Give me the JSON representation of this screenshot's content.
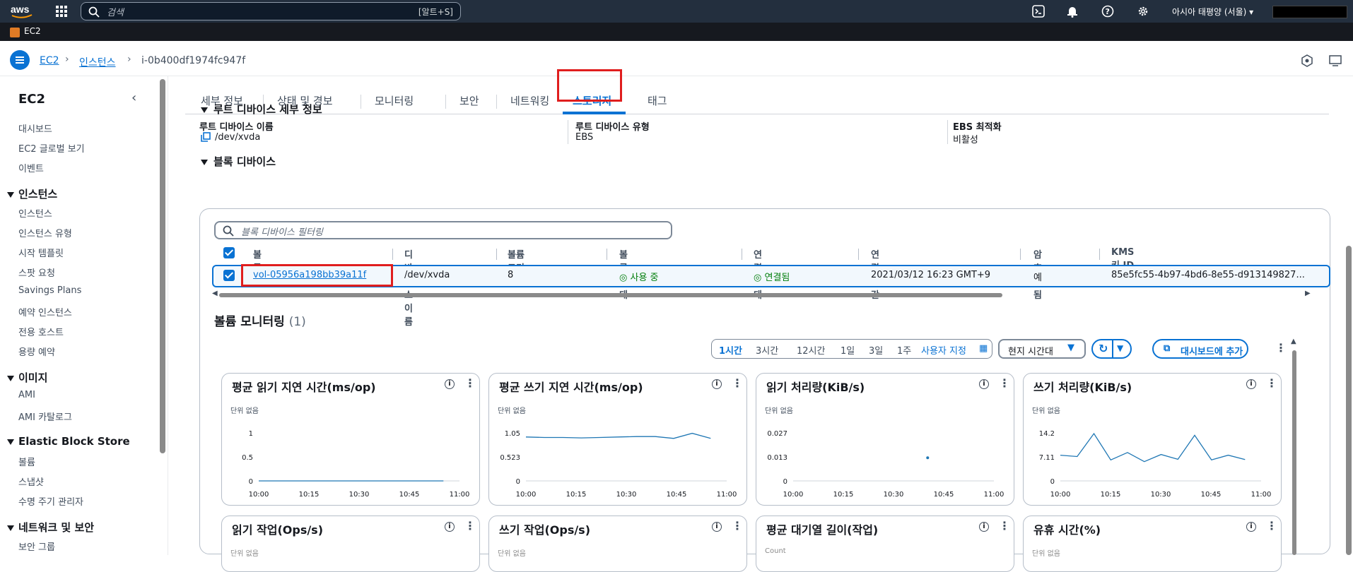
{
  "topnav": {
    "logo": "aws",
    "search_placeholder": "검색",
    "search_shortcut": "[알트+S]",
    "region": "아시아 태평양 (서울)",
    "icons": [
      "cloudshell-icon",
      "bell-icon",
      "help-icon",
      "gear-icon"
    ]
  },
  "service_bar": {
    "label": "EC2"
  },
  "breadcrumb": {
    "items": [
      "EC2",
      "인스턴스",
      "i-0b400df1974fc947f"
    ]
  },
  "sidebar": {
    "title": "EC2",
    "top_items": [
      "대시보드",
      "EC2 글로벌 보기",
      "이벤트"
    ],
    "sections": [
      {
        "title": "인스턴스",
        "items": [
          "인스턴스",
          "인스턴스 유형",
          "시작 템플릿",
          "스팟 요청",
          "Savings Plans",
          "예약 인스턴스",
          "전용 호스트",
          "용량 예약"
        ]
      },
      {
        "title": "이미지",
        "items": [
          "AMI",
          "AMI 카탈로그"
        ]
      },
      {
        "title": "Elastic Block Store",
        "items": [
          "볼륨",
          "스냅샷",
          "수명 주기 관리자"
        ]
      },
      {
        "title": "네트워크 및 보안",
        "items": [
          "보안 그룹"
        ]
      }
    ]
  },
  "tabs": [
    "세부 정보",
    "상태 및 경보",
    "모니터링",
    "보안",
    "네트워킹",
    "스토리지",
    "태그"
  ],
  "active_tab": "스토리지",
  "root_device": {
    "title": "루트 디바이스 세부 정보",
    "name_label": "루트 디바이스 이름",
    "name_value": "/dev/xvda",
    "type_label": "루트 디바이스 유형",
    "type_value": "EBS",
    "ebs_label": "EBS 최적화",
    "ebs_value": "비활성"
  },
  "block_devices": {
    "title": "블록 디바이스",
    "filter_placeholder": "블록 디바이스 필터링",
    "columns": [
      "볼륨 ID",
      "디바이스 이름",
      "볼륨 크기(GiB)",
      "볼륨 상태",
      "연결 상태",
      "연결 시간",
      "암호화됨",
      "KMS 키 ID"
    ],
    "row": {
      "volume_id": "vol-05956a198bb39a11f",
      "device": "/dev/xvda",
      "size": "8",
      "volume_state": "사용 중",
      "attach_state": "연결됨",
      "attach_time": "2021/03/12 16:23 GMT+9",
      "encrypted": "예",
      "kms": "85e5fc55-4b97-4bd6-8e55-d913149827..."
    }
  },
  "monitoring": {
    "title": "볼륨 모니터링",
    "count": "(1)",
    "ranges": [
      "1시간",
      "3시간",
      "12시간",
      "1일",
      "3일",
      "1주"
    ],
    "custom_label": "사용자 지정",
    "timezone": "현지 시간대",
    "add_dashboard": "대시보드에 추가",
    "unit_label": "단위 없음",
    "x_ticks": [
      "10:00",
      "10:15",
      "10:30",
      "10:45",
      "11:00"
    ],
    "cards": [
      {
        "title": "평균 읽기 지연 시간(ms/op)",
        "y_ticks": [
          "1",
          "0.5",
          "0"
        ]
      },
      {
        "title": "평균 쓰기 지연 시간(ms/op)",
        "y_ticks": [
          "1.05",
          "0.523",
          "0"
        ]
      },
      {
        "title": "읽기 처리량(KiB/s)",
        "y_ticks": [
          "0.027",
          "0.013",
          "0"
        ]
      },
      {
        "title": "쓰기 처리량(KiB/s)",
        "y_ticks": [
          "14.2",
          "7.11",
          "0"
        ]
      },
      {
        "title": "읽기 작업(Ops/s)",
        "sub": "단위 없음"
      },
      {
        "title": "쓰기 작업(Ops/s)",
        "sub": "단위 없음"
      },
      {
        "title": "평균 대기열 길이(작업)",
        "sub": "Count"
      },
      {
        "title": "유휴 시간(%)",
        "sub": "단위 없음"
      }
    ]
  },
  "chart_data": [
    {
      "type": "line",
      "title": "평균 읽기 지연 시간(ms/op)",
      "ylim": [
        0,
        1
      ],
      "series": [
        {
          "values": [
            0,
            0,
            0,
            0,
            0,
            0,
            0,
            0,
            0,
            0,
            0
          ]
        }
      ]
    },
    {
      "type": "line",
      "title": "평균 쓰기 지연 시간(ms/op)",
      "ylim": [
        0,
        1.05
      ],
      "series": [
        {
          "values": [
            0.96,
            0.95,
            0.95,
            0.94,
            0.95,
            0.96,
            0.97,
            0.97,
            0.93,
            1.04,
            0.93
          ]
        }
      ]
    },
    {
      "type": "scatter",
      "title": "읽기 처리량(KiB/s)",
      "ylim": [
        0,
        0.027
      ],
      "series": [
        {
          "values": [
            0.013
          ]
        }
      ]
    },
    {
      "type": "line",
      "title": "쓰기 처리량(KiB/s)",
      "ylim": [
        0,
        14.2
      ],
      "series": [
        {
          "values": [
            7.6,
            7.2,
            14.0,
            6.2,
            8.4,
            5.7,
            7.8,
            6.4,
            13.5,
            6.2,
            7.6,
            6.3
          ]
        }
      ]
    }
  ],
  "colors": {
    "accent": "#0972d3",
    "highlight": "#e01e1e",
    "success": "#037f0c",
    "nav": "#232f3e"
  }
}
